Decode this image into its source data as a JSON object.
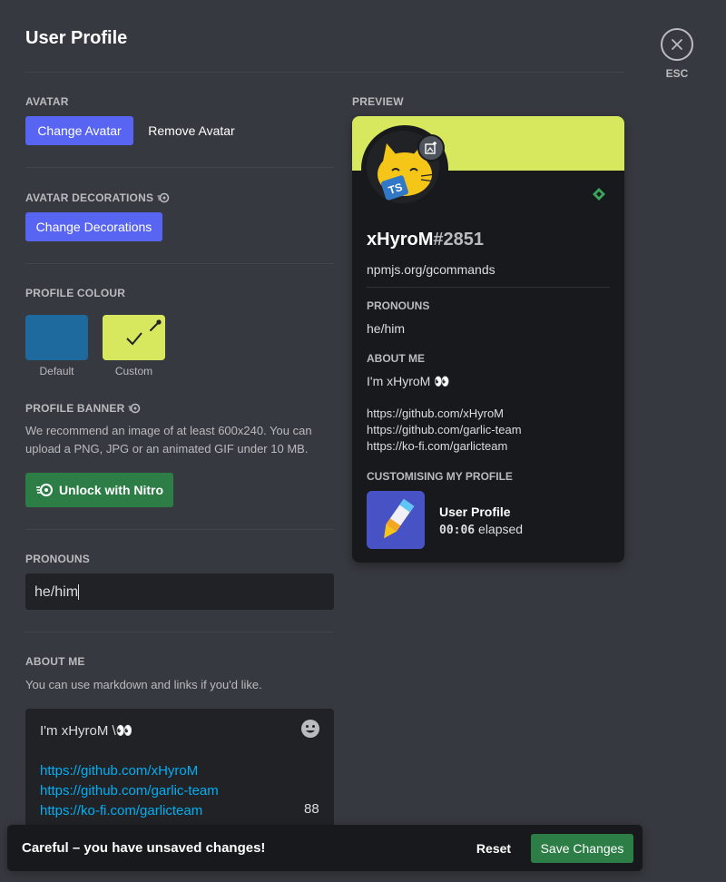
{
  "page": {
    "title": "User Profile",
    "close_label": "ESC"
  },
  "avatar": {
    "label": "Avatar",
    "change_button": "Change Avatar",
    "remove_button": "Remove Avatar"
  },
  "avatar_decorations": {
    "label": "Avatar Decorations",
    "change_button": "Change Decorations"
  },
  "profile_colour": {
    "label": "Profile Colour",
    "default_label": "Default",
    "custom_label": "Custom",
    "default_color": "#1e6a9e",
    "custom_color": "#d8e85e"
  },
  "profile_banner": {
    "label": "Profile Banner",
    "description_line1": "We recommend an image of at least 600x240. You can",
    "description_line2": "upload a PNG, JPG or an animated GIF under 10 MB.",
    "unlock_button": "Unlock with Nitro"
  },
  "pronouns": {
    "label": "Pronouns",
    "value": "he/him"
  },
  "about_me": {
    "label": "About Me",
    "hint": "You can use markdown and links if you'd like.",
    "first_line": "I'm xHyroM \\👀",
    "links": [
      "https://github.com/xHyroM",
      "https://github.com/garlic-team",
      "https://ko-fi.com/garlicteam"
    ],
    "chars_remaining": "88"
  },
  "preview": {
    "label": "Preview",
    "username": "xHyroM",
    "discriminator": "#2851",
    "custom_status": "npmjs.org/gcommands",
    "pronouns_heading": "Pronouns",
    "pronouns_value": "he/him",
    "about_heading": "About Me",
    "about_first_line": "I'm xHyroM 👀",
    "links": [
      "https://github.com/xHyroM",
      "https://github.com/garlic-team",
      "https://ko-fi.com/garlicteam"
    ],
    "activity_heading": "Customising My Profile",
    "activity_title": "User Profile",
    "activity_time": "00:06",
    "activity_time_suffix": "elapsed",
    "avatar_badge_text": "TS"
  },
  "unsaved": {
    "message": "Careful – you have unsaved changes!",
    "reset_label": "Reset",
    "save_label": "Save Changes"
  },
  "colors": {
    "brand": "#5865f2",
    "green": "#2d7d46",
    "link": "#00aff4",
    "banner": "#d8e85e"
  }
}
